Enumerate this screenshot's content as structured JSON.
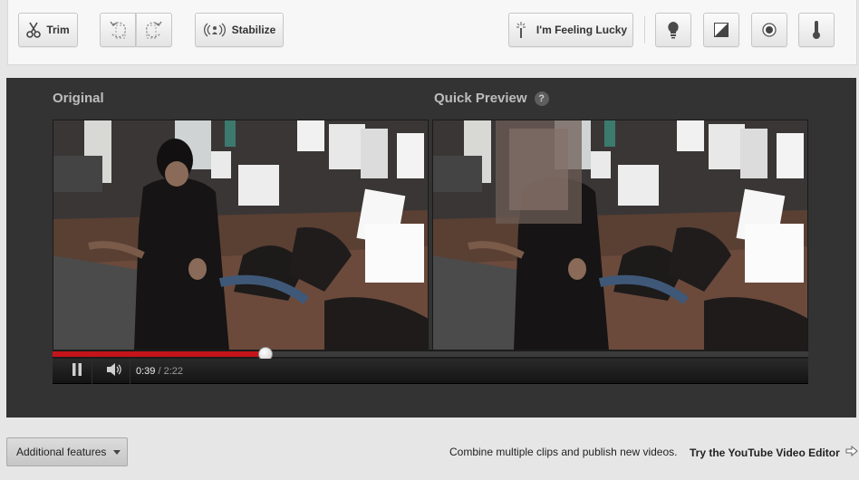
{
  "toolbar": {
    "trim_label": "Trim",
    "rotate_left_icon": "rotate-left-icon",
    "rotate_right_icon": "rotate-right-icon",
    "stabilize_label": "Stabilize",
    "lucky_label": "I'm Feeling Lucky",
    "fill_light_icon": "lightbulb-icon",
    "contrast_icon": "contrast-icon",
    "saturation_icon": "saturation-icon",
    "color_temp_icon": "thermometer-icon"
  },
  "editor": {
    "original_title": "Original",
    "preview_title": "Quick Preview",
    "help_glyph": "?"
  },
  "player": {
    "current_time": "0:39",
    "separator": " / ",
    "total_time": "2:22",
    "progress": 0.282,
    "pause_icon": "pause-icon",
    "volume_icon": "volume-icon"
  },
  "footer": {
    "features_label": "Additional features",
    "promo_text": "Combine multiple clips and publish new videos.",
    "try_link_label": "Try the YouTube Video Editor",
    "arrow_icon": "arrow-right-icon"
  },
  "colors": {
    "progress_fill": "#c4141b",
    "panel_bg": "#333333",
    "toolbar_bg": "#f7f7f7"
  }
}
